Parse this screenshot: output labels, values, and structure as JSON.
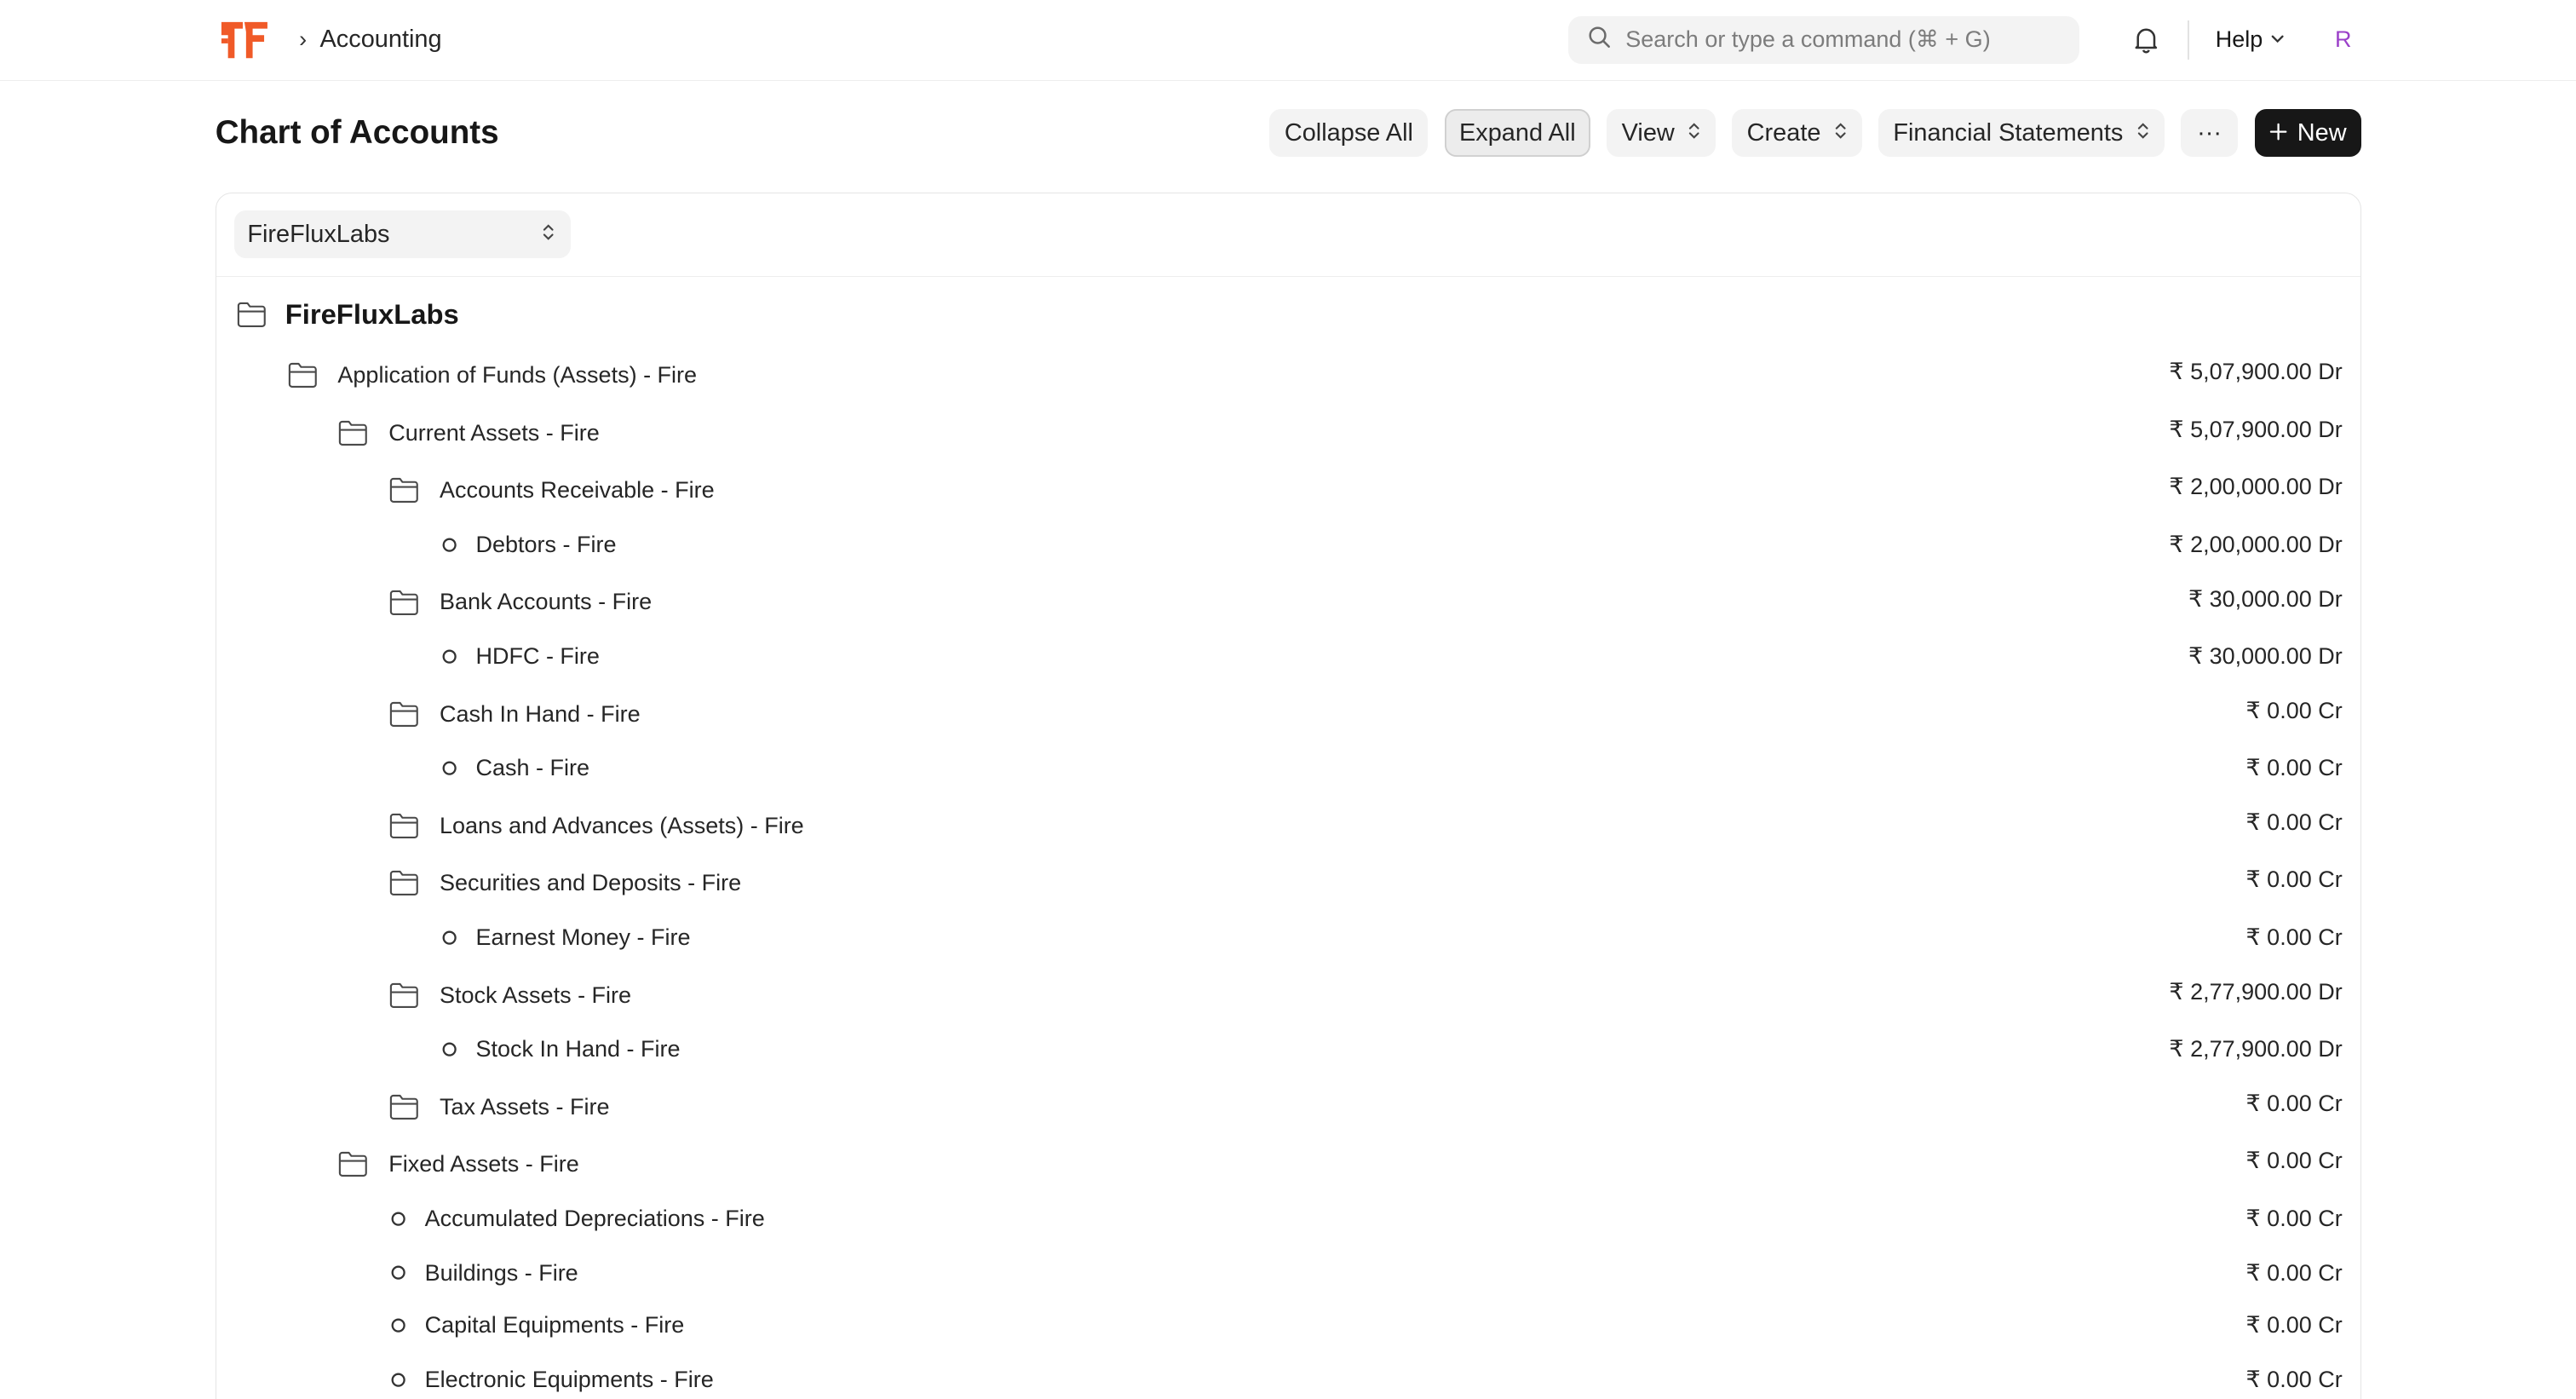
{
  "breadcrumb": {
    "separator": "›",
    "current": "Accounting"
  },
  "search": {
    "placeholder": "Search or type a command (⌘ + G)"
  },
  "nav": {
    "help": "Help",
    "avatar_initial": "R"
  },
  "page": {
    "title": "Chart of Accounts"
  },
  "toolbar": {
    "collapse_all": "Collapse All",
    "expand_all": "Expand All",
    "view": "View",
    "create": "Create",
    "financial_statements": "Financial Statements",
    "more": "···",
    "new": "New"
  },
  "company_select": {
    "value": "FireFluxLabs"
  },
  "tree": {
    "root": "FireFluxLabs",
    "rows": [
      {
        "label": "Application of Funds (Assets) - Fire",
        "balance": "₹ 5,07,900.00 Dr",
        "type": "group"
      },
      {
        "label": "Current Assets - Fire",
        "balance": "₹ 5,07,900.00 Dr",
        "type": "group"
      },
      {
        "label": "Accounts Receivable - Fire",
        "balance": "₹ 2,00,000.00 Dr",
        "type": "group"
      },
      {
        "label": "Debtors - Fire",
        "balance": "₹ 2,00,000.00 Dr",
        "type": "leaf"
      },
      {
        "label": "Bank Accounts - Fire",
        "balance": "₹ 30,000.00 Dr",
        "type": "group"
      },
      {
        "label": "HDFC - Fire",
        "balance": "₹ 30,000.00 Dr",
        "type": "leaf"
      },
      {
        "label": "Cash In Hand - Fire",
        "balance": "₹ 0.00 Cr",
        "type": "group"
      },
      {
        "label": "Cash - Fire",
        "balance": "₹ 0.00 Cr",
        "type": "leaf"
      },
      {
        "label": "Loans and Advances (Assets) - Fire",
        "balance": "₹ 0.00 Cr",
        "type": "group"
      },
      {
        "label": "Securities and Deposits - Fire",
        "balance": "₹ 0.00 Cr",
        "type": "group"
      },
      {
        "label": "Earnest Money - Fire",
        "balance": "₹ 0.00 Cr",
        "type": "leaf"
      },
      {
        "label": "Stock Assets - Fire",
        "balance": "₹ 2,77,900.00 Dr",
        "type": "group"
      },
      {
        "label": "Stock In Hand - Fire",
        "balance": "₹ 2,77,900.00 Dr",
        "type": "leaf"
      },
      {
        "label": "Tax Assets - Fire",
        "balance": "₹ 0.00 Cr",
        "type": "group"
      },
      {
        "label": "Fixed Assets - Fire",
        "balance": "₹ 0.00 Cr",
        "type": "group"
      },
      {
        "label": "Accumulated Depreciations - Fire",
        "balance": "₹ 0.00 Cr",
        "type": "leaf"
      },
      {
        "label": "Buildings - Fire",
        "balance": "₹ 0.00 Cr",
        "type": "leaf"
      },
      {
        "label": "Capital Equipments - Fire",
        "balance": "₹ 0.00 Cr",
        "type": "leaf"
      },
      {
        "label": "Electronic Equipments - Fire",
        "balance": "₹ 0.00 Cr",
        "type": "leaf"
      }
    ]
  },
  "colors": {
    "brand": "#f05a28",
    "accent_dark": "#171717",
    "avatar": "#9b41c9"
  }
}
